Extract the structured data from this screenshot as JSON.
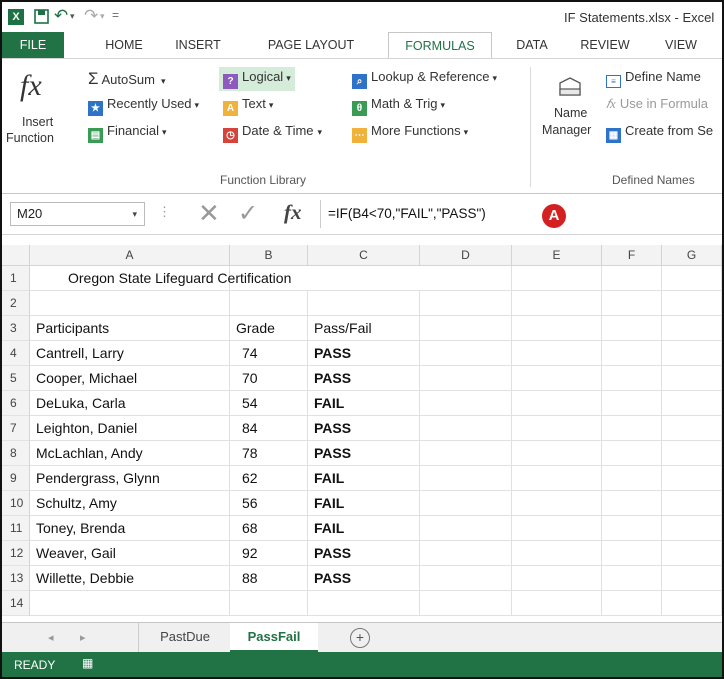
{
  "title": "IF Statements.xlsx - Excel",
  "quick_access": {
    "app_icon": "X",
    "save_icon": "save-icon",
    "undo_icon": "undo-icon",
    "redo_icon": "redo-icon"
  },
  "tabs": [
    "FILE",
    "HOME",
    "INSERT",
    "PAGE LAYOUT",
    "FORMULAS",
    "DATA",
    "REVIEW",
    "VIEW"
  ],
  "active_tab": "FORMULAS",
  "ribbon": {
    "insert_function": {
      "icon": "fx",
      "label_line1": "Insert",
      "label_line2": "Function"
    },
    "function_library": {
      "autosum": "AutoSum",
      "recently_used": "Recently Used",
      "financial": "Financial",
      "logical": "Logical",
      "text": "Text",
      "date_time": "Date & Time",
      "lookup_reference": "Lookup & Reference",
      "math_trig": "Math & Trig",
      "more_functions": "More Functions",
      "group_label": "Function Library"
    },
    "defined_names": {
      "name_manager_line1": "Name",
      "name_manager_line2": "Manager",
      "define_name": "Define Name",
      "use_in_formula": "Use in Formula",
      "create_from_selection": "Create from Se",
      "group_label": "Defined Names"
    }
  },
  "formula_bar": {
    "name_box": "M20",
    "fx": "fx",
    "formula": "=IF(B4<70,\"FAIL\",\"PASS\")",
    "callout": "A"
  },
  "columns": [
    "A",
    "B",
    "C",
    "D",
    "E",
    "F",
    "G"
  ],
  "rows": [
    "1",
    "2",
    "3",
    "4",
    "5",
    "6",
    "7",
    "8",
    "9",
    "10",
    "11",
    "12",
    "13",
    "14"
  ],
  "sheet": {
    "title": "Oregon State Lifeguard Certification",
    "headers": [
      "Participants",
      "Grade",
      "Pass/Fail"
    ],
    "data": [
      [
        "Cantrell, Larry",
        "74",
        "PASS"
      ],
      [
        "Cooper, Michael",
        "70",
        "PASS"
      ],
      [
        "DeLuka, Carla",
        "54",
        "FAIL"
      ],
      [
        "Leighton, Daniel",
        "84",
        "PASS"
      ],
      [
        "McLachlan, Andy",
        "78",
        "PASS"
      ],
      [
        "Pendergrass, Glynn",
        "62",
        "FAIL"
      ],
      [
        "Schultz, Amy",
        "56",
        "FAIL"
      ],
      [
        "Toney, Brenda",
        "68",
        "FAIL"
      ],
      [
        "Weaver, Gail",
        "92",
        "PASS"
      ],
      [
        "Willette, Debbie",
        "88",
        "PASS"
      ]
    ]
  },
  "sheet_tabs": [
    "PastDue",
    "PassFail"
  ],
  "active_sheet": "PassFail",
  "status": "READY",
  "colors": {
    "accent": "#217346",
    "callout": "#d42020"
  }
}
